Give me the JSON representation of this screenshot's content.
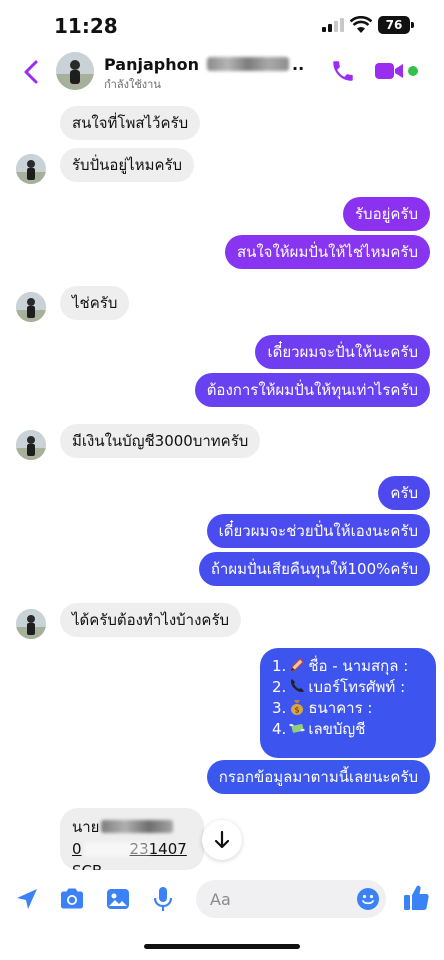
{
  "status_bar": {
    "time": "11:28",
    "battery": "76"
  },
  "header": {
    "name": "Panjaphon",
    "name_ellipsis": "..",
    "status": "กำลังใช้งาน",
    "colors": {
      "accent": "#9b2df0",
      "online": "#31c24d"
    }
  },
  "messages": [
    {
      "side": "in",
      "text": "สนใจที่โพสไว้ครับ",
      "avatar": false
    },
    {
      "side": "in",
      "text": "รับปั่นอยู่ไหมครับ",
      "avatar": true
    },
    {
      "side": "out",
      "text": "รับอยู่ครับ"
    },
    {
      "side": "out",
      "text": "สนใจให้ผมปั่นให้ไช่ไหมครับ"
    },
    {
      "side": "in",
      "text": "ไช่ครับ",
      "avatar": true
    },
    {
      "side": "out",
      "text": "เดี๋ยวผมจะปั่นให้นะครับ"
    },
    {
      "side": "out",
      "text": "ต้องการให้ผมปั่นให้ทุนเท่าไรครับ"
    },
    {
      "side": "in",
      "text": "มีเงินในบัญชี3000บาทครับ",
      "avatar": true
    },
    {
      "side": "out",
      "text": "ครับ"
    },
    {
      "side": "out",
      "text": "เดี๋ยวผมจะช่วยปั่นให้เองนะครับ"
    },
    {
      "side": "out",
      "text": "ถ้าผมปั่นเสียคืนทุนให้100%ครับ"
    },
    {
      "side": "in",
      "text": "ได้ครับต้องทำไงบ้างครับ",
      "avatar": true
    },
    {
      "side": "out",
      "text": "กรอกข้อมูลมาตามนี้เลยนะครับ"
    }
  ],
  "form_list": {
    "items": [
      {
        "num": "1.",
        "icon": "pencil-icon",
        "label": "ชื่อ - นามสกุล :"
      },
      {
        "num": "2.",
        "icon": "telephone-icon",
        "label": "เบอร์โทรศัพท์ :"
      },
      {
        "num": "3.",
        "icon": "money-bag-icon",
        "label": "ธนาคาร :"
      },
      {
        "num": "4.",
        "icon": "money-wings-icon",
        "label": "เลขบัญชี"
      }
    ]
  },
  "partial_reply": {
    "line1": "นาย",
    "line2_prefix": "0",
    "line2_suffix": "231407",
    "line3": "SCB"
  },
  "composer": {
    "placeholder": "Aa"
  }
}
